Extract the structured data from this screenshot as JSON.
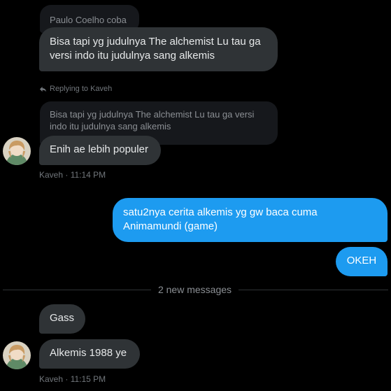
{
  "messages": {
    "quote1": "Paulo Coelho coba",
    "msg1": "Bisa tapi yg judulnya The alchemist Lu tau ga versi indo itu judulnya sang alkemis",
    "replying_label": "Replying to Kaveh",
    "quote2": "Bisa tapi yg judulnya The alchemist Lu tau ga versi indo itu judulnya sang alkemis",
    "msg2": "Enih ae lebih populer",
    "meta2": "Kaveh · 11:14 PM",
    "out1": "satu2nya cerita alkemis yg gw baca cuma Animamundi (game)",
    "out2": "OKEH",
    "divider": "2 new messages",
    "msg3": "Gass",
    "msg4": "Alkemis 1988 ye",
    "meta4": "Kaveh · 11:15 PM"
  },
  "colors": {
    "background": "#000000",
    "incoming_bubble": "#2f3336",
    "outgoing_bubble": "#1d9bf0",
    "quote_bubble": "#16181c",
    "meta_text": "#71767b"
  },
  "icons": {
    "reply": "reply-arrow-icon",
    "avatar": "user-avatar"
  }
}
